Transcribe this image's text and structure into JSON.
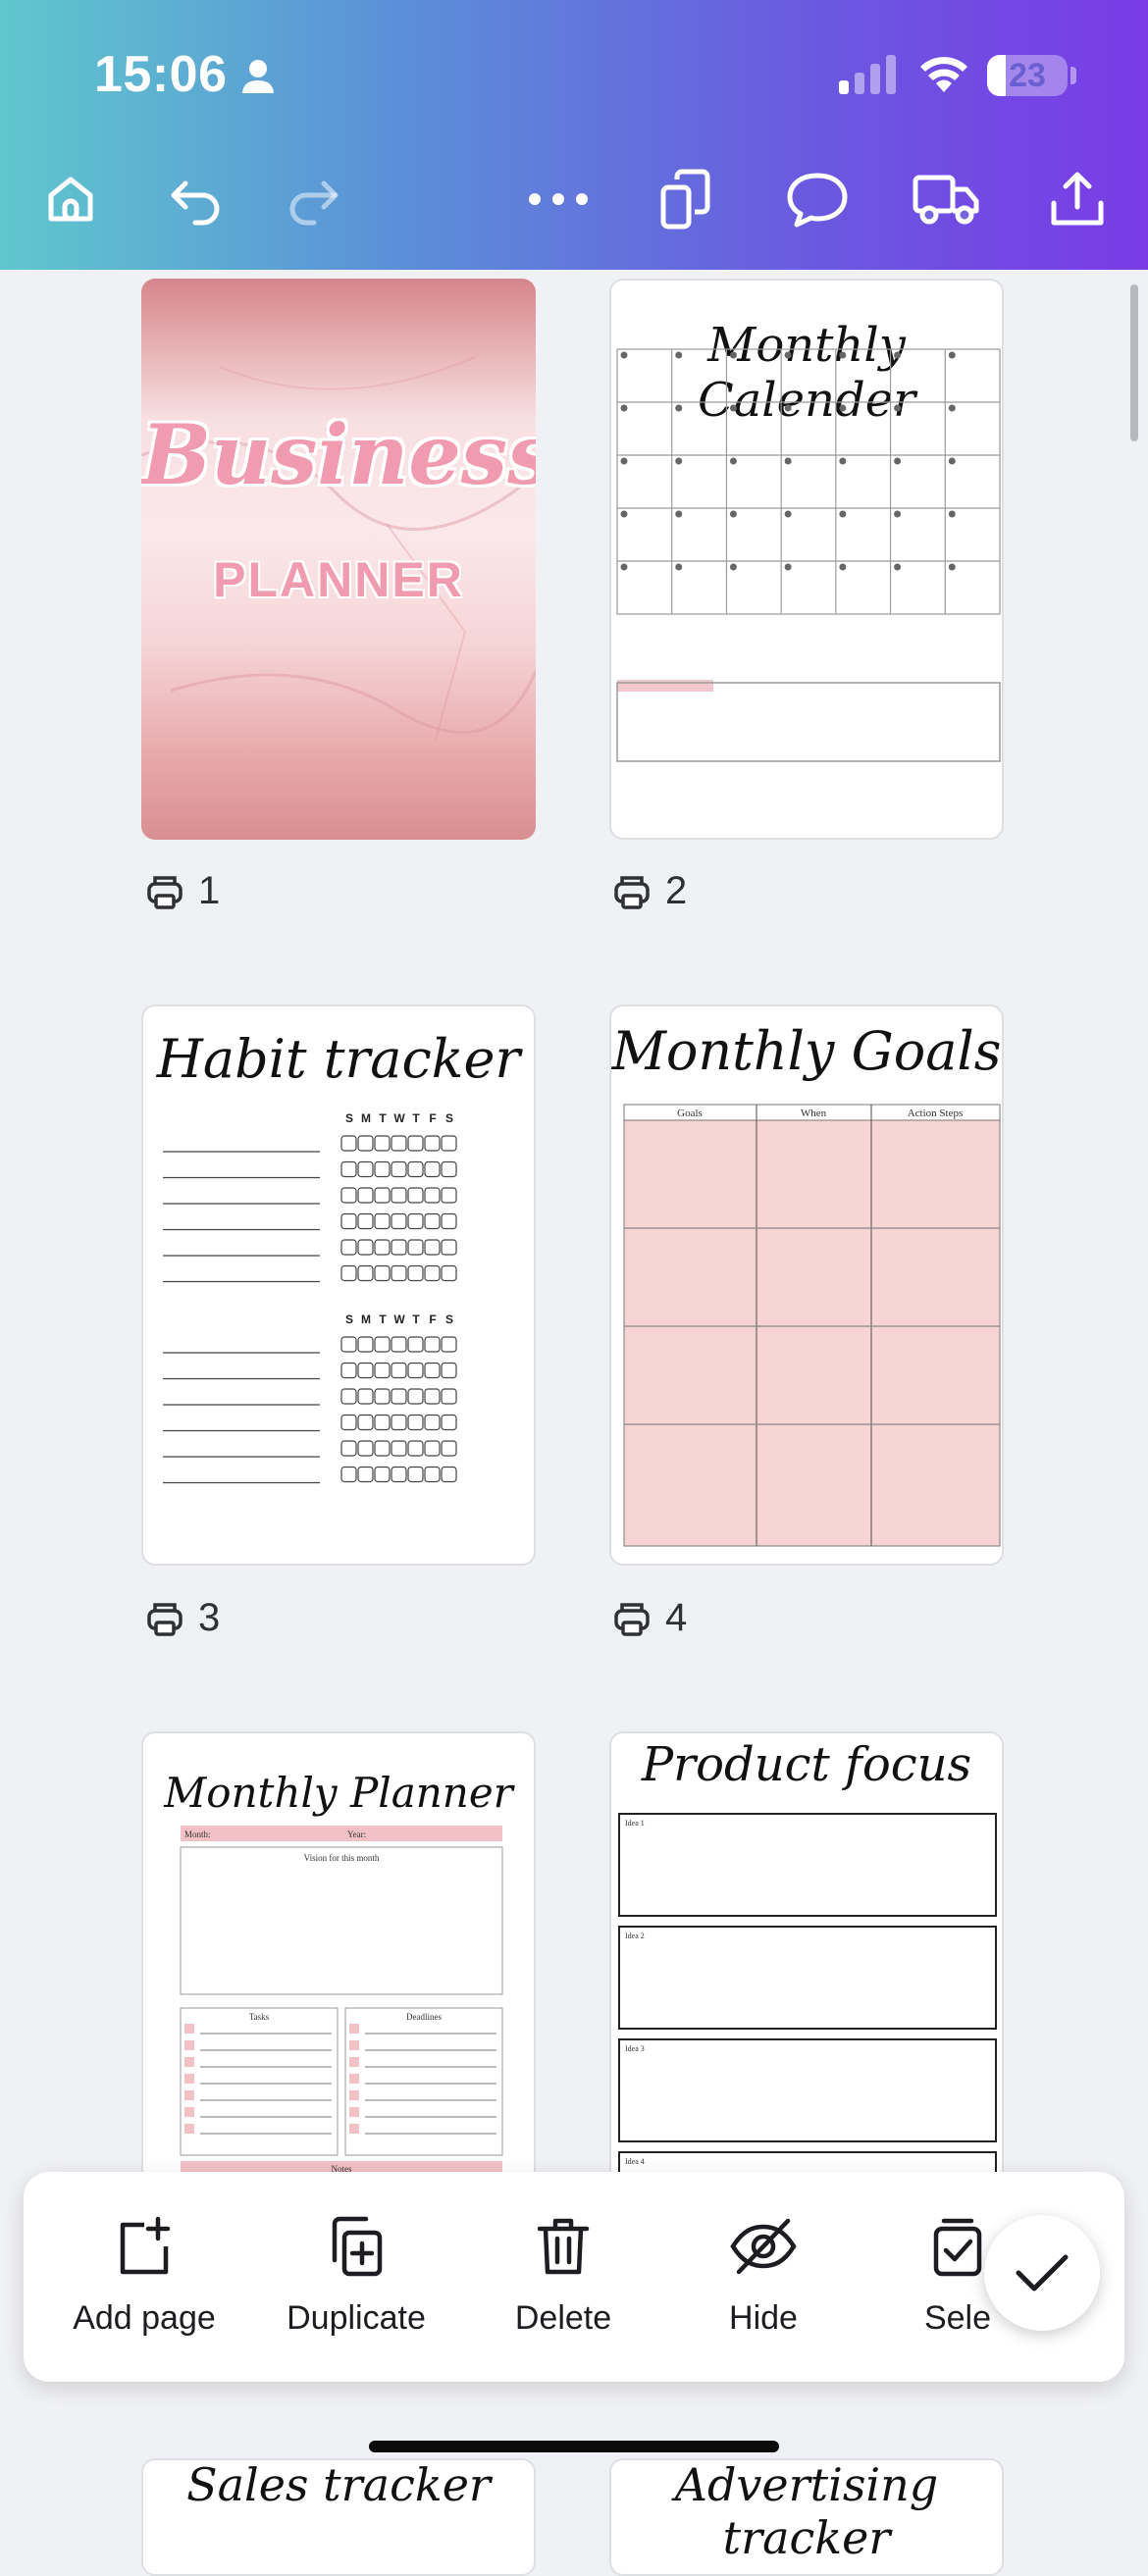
{
  "status_bar": {
    "time": "15:06",
    "battery": "23",
    "battery_level": 0.23
  },
  "toolbar": {
    "icons": [
      "home-icon",
      "undo-icon",
      "redo-icon",
      "more-icon",
      "pages-icon",
      "comment-icon",
      "truck-icon",
      "share-icon"
    ]
  },
  "pages": [
    {
      "number": "1",
      "title": "Business",
      "subtitle": "PLANNER"
    },
    {
      "number": "2",
      "title": "Monthly Calender"
    },
    {
      "number": "3",
      "title": "Habit tracker",
      "days": [
        "S",
        "M",
        "T",
        "W",
        "T",
        "F",
        "S"
      ]
    },
    {
      "number": "4",
      "title": "Monthly Goals",
      "columns": [
        "Goals",
        "When",
        "Action Steps"
      ]
    },
    {
      "title": "Monthly Planner",
      "month_label": "Month:",
      "year_label": "Year:",
      "vision_label": "Vision for this month",
      "tasks_label": "Tasks",
      "deadlines_label": "Deadlines",
      "notes_label": "Notes"
    },
    {
      "title": "Product focus",
      "box_labels": [
        "Idea 1",
        "Idea 2",
        "Idea 3",
        "Idea 4"
      ]
    },
    {
      "title": "Sales tracker"
    },
    {
      "title": "Advertising tracker"
    }
  ],
  "actions": {
    "add_page": "Add page",
    "duplicate": "Duplicate",
    "delete": "Delete",
    "hide": "Hide",
    "select": "Sele"
  },
  "colors": {
    "pink_fill": "#f7d4d4",
    "pink_text": "#f09bb0",
    "accent_gradient_start": "#5fc7cd",
    "accent_gradient_end": "#7a3be6"
  }
}
